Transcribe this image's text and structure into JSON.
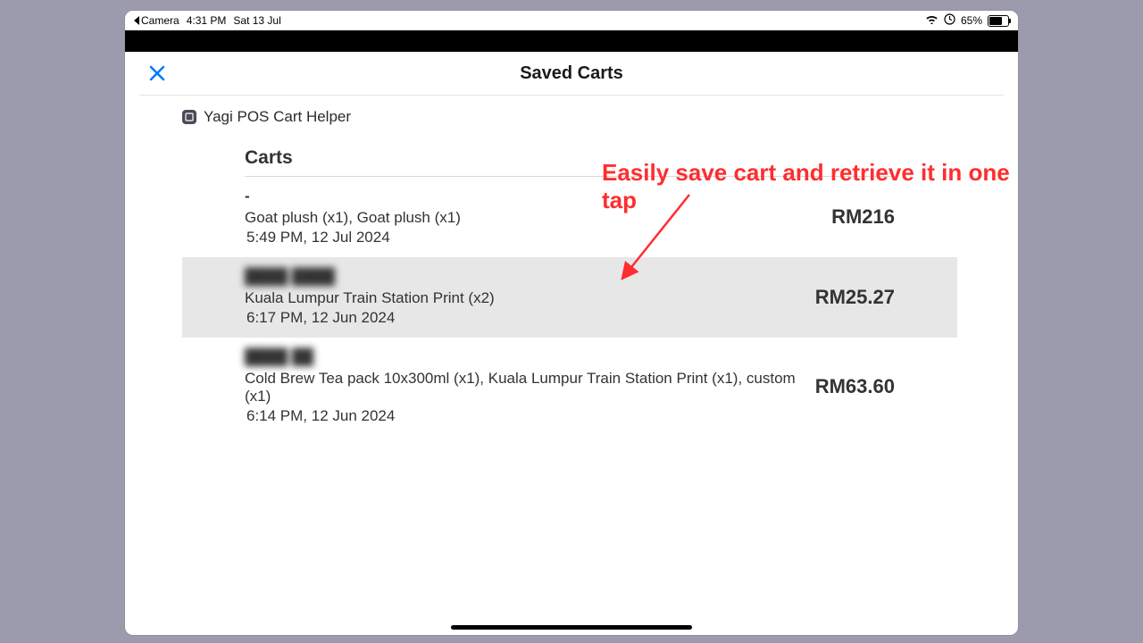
{
  "status": {
    "back_app": "Camera",
    "time": "4:31 PM",
    "date": "Sat 13 Jul",
    "battery": "65%"
  },
  "header": {
    "title": "Saved Carts"
  },
  "app": {
    "name": "Yagi POS Cart Helper"
  },
  "section": {
    "title": "Carts"
  },
  "carts": [
    {
      "customer": "-",
      "items": "Goat plush (x1), Goat plush (x1)",
      "time": "5:49 PM, 12 Jul 2024",
      "price": "RM216",
      "selected": false,
      "blur": false
    },
    {
      "customer": "████ ████",
      "items": "Kuala Lumpur Train Station Print (x2)",
      "time": "6:17 PM, 12 Jun 2024",
      "price": "RM25.27",
      "selected": true,
      "blur": true
    },
    {
      "customer": "████ ██",
      "items": "Cold Brew Tea pack 10x300ml (x1), Kuala Lumpur Train Station Print (x1), custom (x1)",
      "time": "6:14 PM, 12 Jun 2024",
      "price": "RM63.60",
      "selected": false,
      "blur": true
    }
  ],
  "annotation": "Easily save cart and retrieve it in one tap"
}
